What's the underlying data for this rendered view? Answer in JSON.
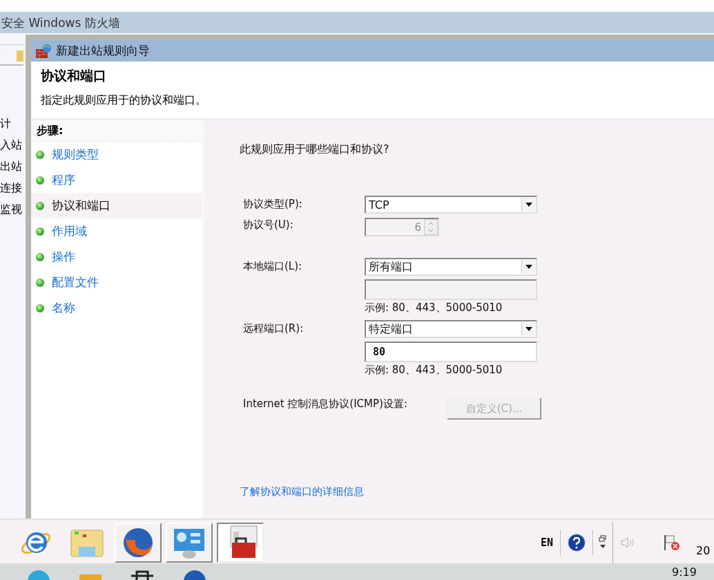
{
  "background_window": {
    "title": "安全 Windows 防火墙",
    "tree_items": [
      "计",
      "入站",
      "出站",
      "连接",
      "监视"
    ]
  },
  "dialog": {
    "title": "新建出站规则向导",
    "heading": "协议和端口",
    "subtitle": "指定此规则应用于的协议和端口。"
  },
  "steps": {
    "title": "步骤:",
    "items": [
      {
        "label": "规则类型",
        "selected": false
      },
      {
        "label": "程序",
        "selected": false
      },
      {
        "label": "协议和端口",
        "selected": true
      },
      {
        "label": "作用域",
        "selected": false
      },
      {
        "label": "操作",
        "selected": false
      },
      {
        "label": "配置文件",
        "selected": false
      },
      {
        "label": "名称",
        "selected": false
      }
    ]
  },
  "form": {
    "question": "此规则应用于哪些端口和协议?",
    "protocol_type": {
      "label": "协议类型(P):",
      "value": "TCP"
    },
    "protocol_number": {
      "label": "协议号(U):",
      "value": "6",
      "disabled": true
    },
    "local_port": {
      "label": "本地端口(L):",
      "value": "所有端口",
      "ports_disabled": true,
      "example": "示例: 80、443、5000-5010"
    },
    "remote_port": {
      "label": "远程端口(R):",
      "value": "特定端口",
      "ports": "80",
      "ports_disabled": false,
      "example": "示例: 80、443、5000-5010"
    },
    "icmp": {
      "label": "Internet 控制消息协议(ICMP)设置:",
      "button": "自定义(C)...",
      "button_disabled": true
    },
    "link": "了解协议和端口的详细信息"
  },
  "taskbar": {
    "language": "EN",
    "clock_partial": "20"
  },
  "system_bar": {
    "time": "9:19"
  }
}
